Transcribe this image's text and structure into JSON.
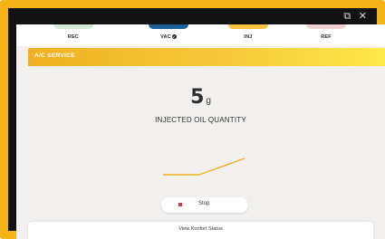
{
  "window": {
    "icons": [
      "external-link-icon",
      "close-icon"
    ]
  },
  "steps": [
    {
      "label": "REC",
      "color": "#d6ead9"
    },
    {
      "label": "VAC",
      "color": "#1d5f99",
      "completed": true
    },
    {
      "label": "INJ",
      "color": "#f5c33b"
    },
    {
      "label": "REF",
      "color": "#f1d3d6"
    }
  ],
  "banner": {
    "title": "A/C SERVICE"
  },
  "reading": {
    "value": "5",
    "unit": "g",
    "caption": "INJECTED OIL QUANTITY"
  },
  "chart_data": {
    "type": "line",
    "series": [
      {
        "values": [
          0,
          0,
          0,
          0,
          0,
          1,
          2,
          3,
          4,
          5
        ]
      }
    ]
  },
  "controls": {
    "stop_label": "Stop"
  },
  "footer": {
    "status_label": "View Konfort Status"
  },
  "colors": {
    "frame": "#f4b418",
    "accent": "#f0b020",
    "stop": "#e2343a"
  }
}
